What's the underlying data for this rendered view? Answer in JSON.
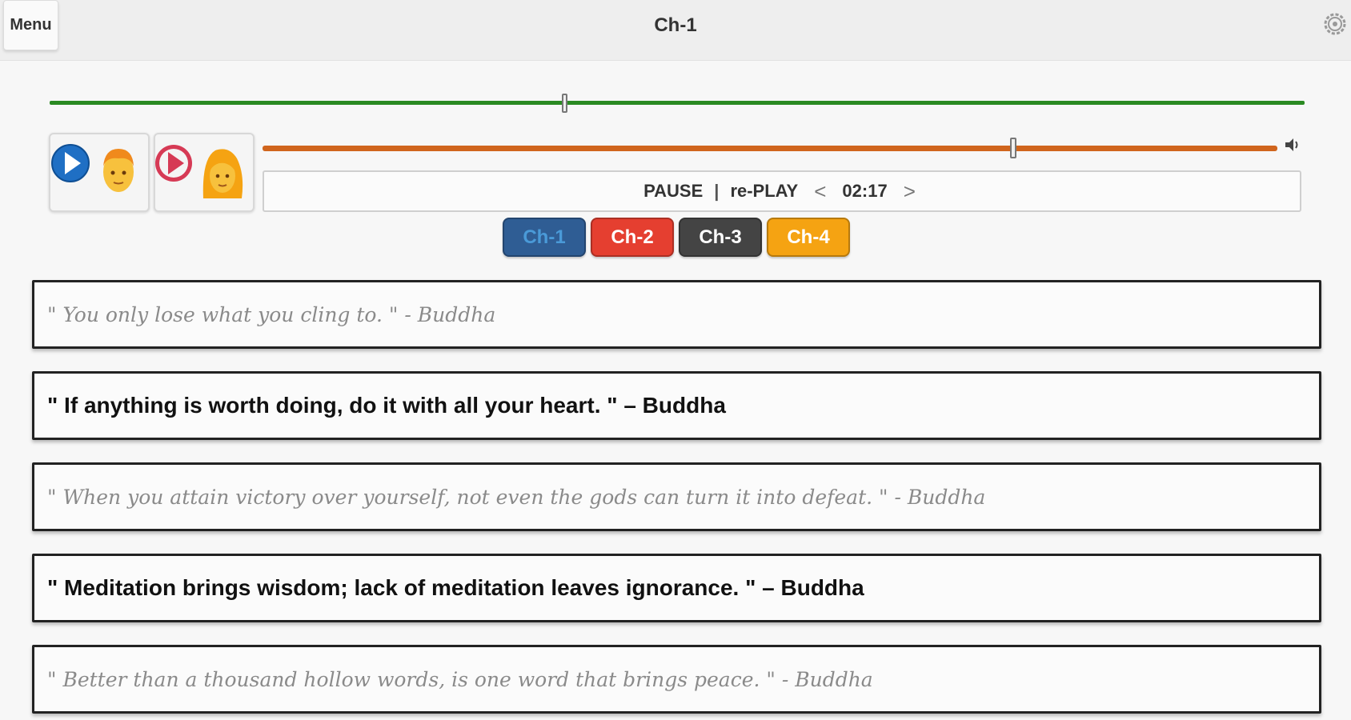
{
  "header": {
    "menu_label": "Menu",
    "title": "Ch-1",
    "settings_icon": "gear-icon"
  },
  "playback": {
    "progress_fraction": 0.41,
    "volume_fraction": 0.74,
    "pause_label": "PAUSE",
    "separator": "|",
    "replay_label": "re-PLAY",
    "prev_symbol": "<",
    "next_symbol": ">",
    "time": "02:17"
  },
  "players": [
    {
      "name": "male-voice",
      "play_color": "#1f6fc4",
      "icon": "play-icon",
      "face": "man-face-icon"
    },
    {
      "name": "female-voice",
      "play_color": "#d63a55",
      "icon": "play-icon",
      "face": "woman-face-icon"
    }
  ],
  "chapters": [
    {
      "label": "Ch-1",
      "bg": "#2f5d94",
      "text": "#4a9ad8"
    },
    {
      "label": "Ch-2",
      "bg": "#e53f30",
      "text": "#ffffff"
    },
    {
      "label": "Ch-3",
      "bg": "#444444",
      "text": "#ffffff"
    },
    {
      "label": "Ch-4",
      "bg": "#f5a312",
      "text": "#ffffff"
    }
  ],
  "quotes": [
    {
      "text": "\" You only lose what you cling to. \" - Buddha",
      "style": "dim"
    },
    {
      "text": "\" If anything is worth doing, do it with all your heart. \" – Buddha",
      "style": "bold"
    },
    {
      "text": "\" When you attain victory over yourself, not even the gods can turn it into defeat. \" - Buddha",
      "style": "dim"
    },
    {
      "text": "\" Meditation brings wisdom; lack of meditation leaves ignorance. \" – Buddha",
      "style": "bold"
    },
    {
      "text": "\" Better than a thousand hollow words, is one word that brings peace. \" - Buddha",
      "style": "dim"
    }
  ]
}
